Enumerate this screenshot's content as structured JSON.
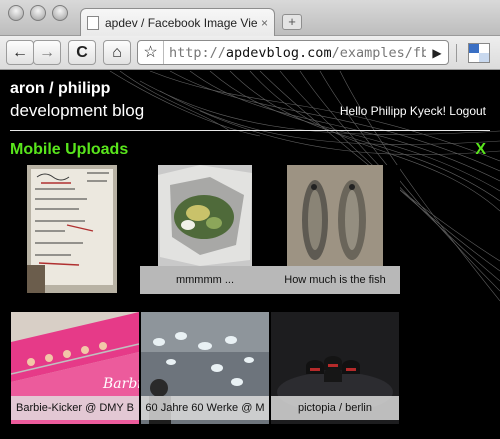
{
  "browser": {
    "tab_title": "apdev / Facebook Image Viewer",
    "tab_close": "×",
    "new_tab": "+",
    "back": "←",
    "forward": "→",
    "reload": "C",
    "home": "⌂",
    "bookmark": "☆",
    "url_prefix": "http://",
    "url_domain": "apdevblog.com",
    "url_path": "/examples/fbconnect/",
    "go": "▶"
  },
  "page": {
    "blog_title": "aron / philipp",
    "blog_subtitle": "development blog",
    "user_greeting": "Hello Philipp Kyeck!",
    "logout": "Logout",
    "album_title": "Mobile Uploads",
    "close": "X"
  },
  "photos": [
    {
      "caption": ""
    },
    {
      "caption": "mmmmm ..."
    },
    {
      "caption": "How much is the fish"
    },
    {
      "caption": "Barbie-Kicker @ DMY B"
    },
    {
      "caption": "60 Jahre 60 Werke @ M"
    },
    {
      "caption": "pictopia / berlin"
    }
  ],
  "colors": {
    "accent": "#59e51c",
    "background": "#000000"
  }
}
